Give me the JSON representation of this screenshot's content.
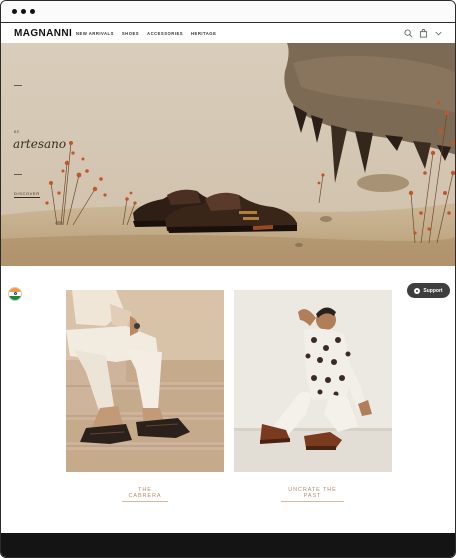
{
  "header": {
    "logo": "MAGNANNI",
    "nav": [
      "NEW ARRIVALS",
      "SHOES",
      "ACCESSORIES",
      "HERITAGE"
    ],
    "icons": [
      "search-icon",
      "bag-icon",
      "chevron-down-icon"
    ]
  },
  "hero": {
    "pre_title": "BE",
    "title": "artesano",
    "cta": "DISCOVER",
    "colors": {
      "sand": "#cdb99b",
      "sky": "#d8ccba",
      "shoe": "#2f1e16",
      "flowers": "#c0572a"
    }
  },
  "locale_flag": {
    "colors": [
      "#f19a37",
      "#ffffff",
      "#188a3e"
    ]
  },
  "support": {
    "label": "Support",
    "bg": "#3e3e3e"
  },
  "collections": [
    {
      "link": "THE CABRERA"
    },
    {
      "link": "UNCRATE THE PAST"
    }
  ]
}
